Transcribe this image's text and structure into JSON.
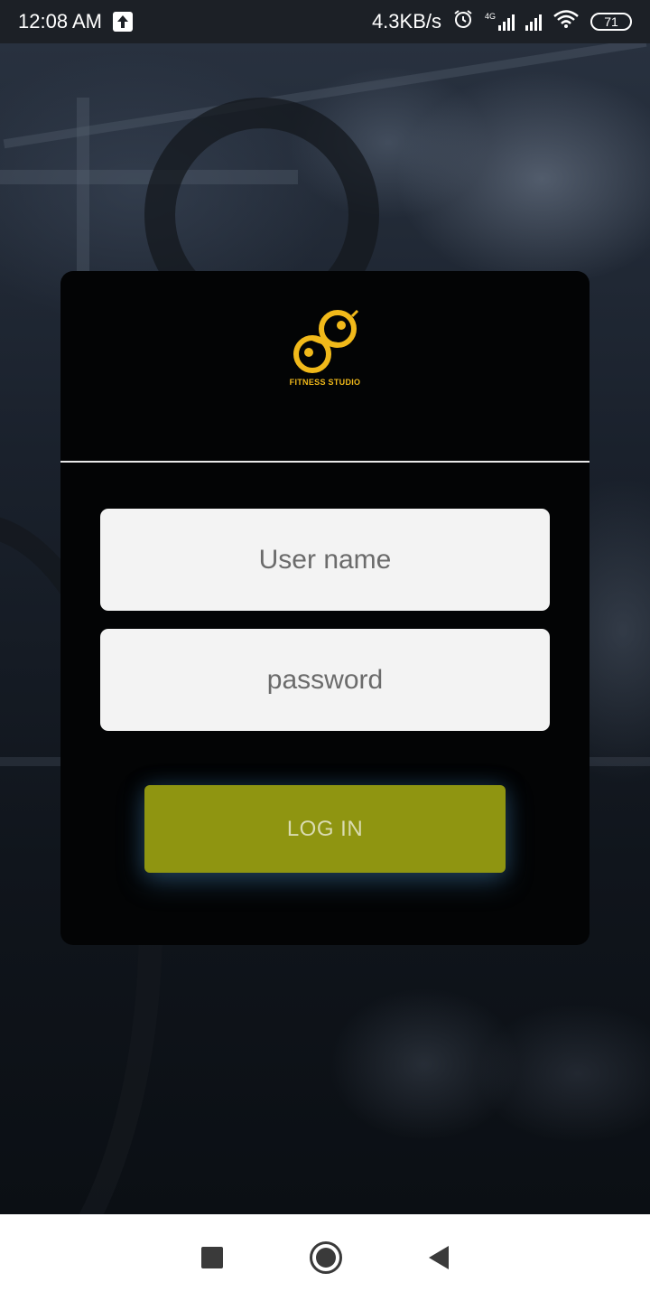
{
  "status_bar": {
    "time": "12:08 AM",
    "network_speed": "4.3KB/s",
    "network_type": "4G",
    "battery": "71",
    "icons": [
      "upload-icon",
      "alarm-icon",
      "signal-4g-icon",
      "signal-icon",
      "wifi-icon",
      "battery-icon"
    ]
  },
  "logo": {
    "text": "FITNESS STUDIO",
    "color": "#f1b91a"
  },
  "login_form": {
    "username_placeholder": "User name",
    "username_value": "",
    "password_placeholder": "password",
    "password_value": "",
    "login_label": "LOG IN"
  },
  "colors": {
    "card_background": "#030405",
    "field_background": "#f3f3f3",
    "button_background": "#8f9511",
    "button_text": "#d9dbb0"
  },
  "nav_bar": {
    "icons": [
      "recents-icon",
      "home-icon",
      "back-icon"
    ]
  }
}
